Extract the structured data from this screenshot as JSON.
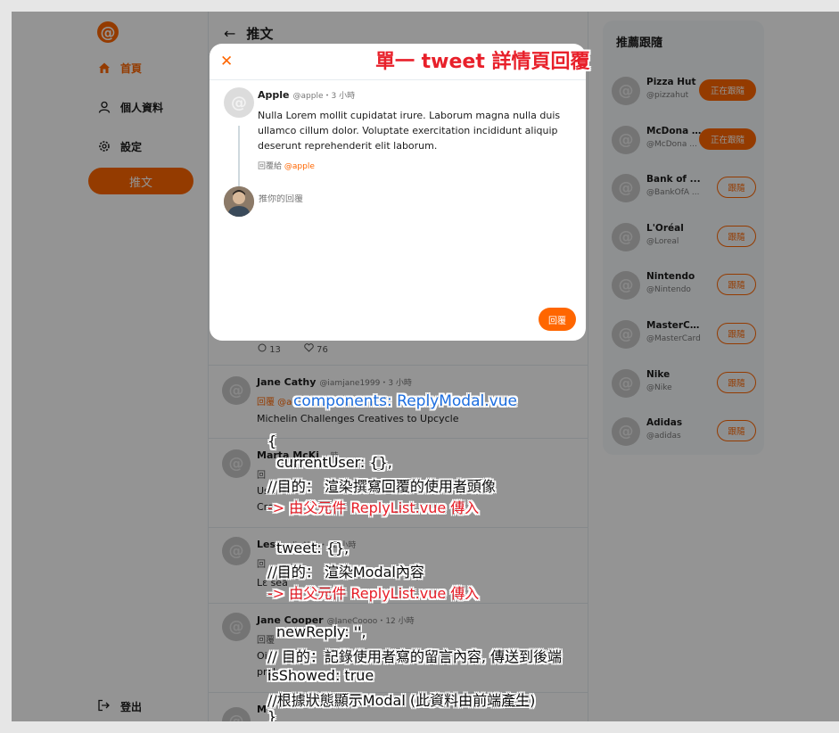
{
  "sidebar": {
    "nav": [
      {
        "label": "首頁",
        "icon": "home-icon",
        "active": true
      },
      {
        "label": "個人資料",
        "icon": "user-icon",
        "active": false
      },
      {
        "label": "設定",
        "icon": "gear-icon",
        "active": false
      }
    ],
    "tweet_button": "推文",
    "logout": "登出"
  },
  "main": {
    "title": "推文",
    "actions": {
      "replies": "13",
      "likes": "76"
    },
    "feed": [
      {
        "name": "Jane Cathy",
        "meta": "@iamjane1999・3 小時",
        "line": "回覆 @ac",
        "body": "Michelin Challenges Creatives to Upcycle"
      },
      {
        "name": "Marta McKi",
        "meta": "·· 時",
        "line": "回",
        "body": "Use",
        "body2": "Cre"
      },
      {
        "name": "Les",
        "meta": "LeslieAlex・12 小時",
        "line": "回",
        "body": "Lε sea"
      },
      {
        "name": "Jane Cooper",
        "meta": "@JaneCoooo・12 小時",
        "line": "回覆",
        "body": "Oi",
        "body2": "prol"
      },
      {
        "name": "M",
        "meta": "",
        "line": "",
        "body": ""
      }
    ]
  },
  "modal": {
    "author_name": "Apple",
    "author_meta": "@apple・3 小時",
    "body": "Nulla Lorem mollit cupidatat irure. Laborum magna nulla duis ullamco cillum dolor. Voluptate exercitation incididunt aliquip deserunt reprehenderit elit laborum.",
    "reply_to_prefix": "回覆給",
    "reply_to_handle": "@apple",
    "input_placeholder": "推你的回覆",
    "reply_button": "回覆"
  },
  "recommend": {
    "title": "推薦跟隨",
    "items": [
      {
        "name": "Pizza Hut",
        "handle": "@pizzahut",
        "button": "正在跟隨",
        "following": true
      },
      {
        "name": "McDona ...",
        "handle": "@McDona ...",
        "button": "正在跟隨",
        "following": true
      },
      {
        "name": "Bank of ...",
        "handle": "@BankOfA ...",
        "button": "跟隨",
        "following": false
      },
      {
        "name": "L'Oréal",
        "handle": "@Loreal",
        "button": "跟隨",
        "following": false
      },
      {
        "name": "Nintendo",
        "handle": "@Nintendo",
        "button": "跟隨",
        "following": false
      },
      {
        "name": "MasterCard",
        "handle": "@MasterCard",
        "button": "跟隨",
        "following": false
      },
      {
        "name": "Nike",
        "handle": "@Nike",
        "button": "跟隨",
        "following": false
      },
      {
        "name": "Adidas",
        "handle": "@adidas",
        "button": "跟隨",
        "following": false
      }
    ]
  },
  "annotations": {
    "title": "單一 tweet 詳情頁回覆",
    "component": "components: ReplyModal.vue",
    "l01": "{",
    "l02": "currentUser: {},",
    "l03": "//目的： 渲染撰寫回覆的使用者頭像",
    "l04": "-> 由父元件 ReplyList.vue 傳入",
    "l05": "tweet: {},",
    "l06": "//目的： 渲染Modal內容",
    "l07": "-> 由父元件 ReplyList.vue 傳入",
    "l08": "newReply: '',",
    "l09": "// 目的：記錄使用者寫的留言內容, 傳送到後端",
    "l10": "isShowed: true",
    "l11": "//根據狀態顯示Modal (此資料由前端產生)",
    "l12": "}"
  },
  "colors": {
    "accent": "#ff6600",
    "annotation_red": "#e8202a",
    "annotation_blue": "#1e6fe0"
  }
}
